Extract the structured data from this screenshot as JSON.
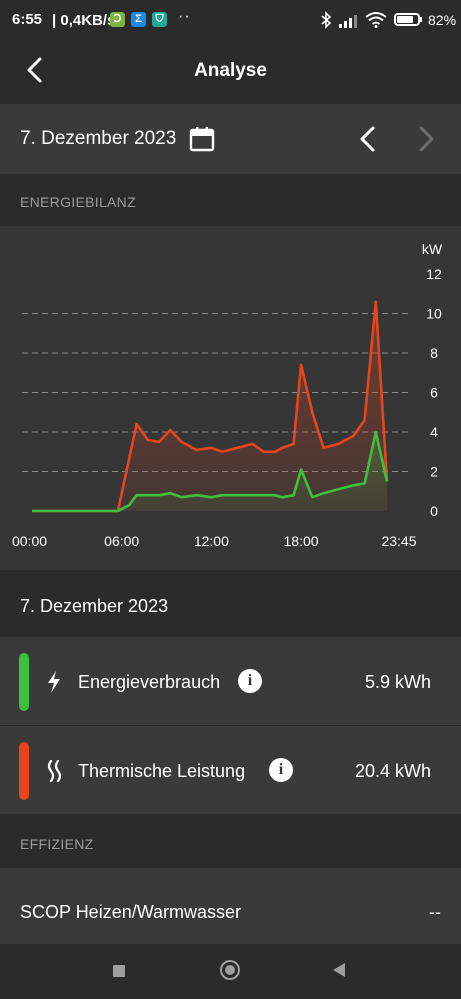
{
  "status_bar": {
    "time": "6:55",
    "speed": "| 0,4KB/s",
    "app_icons": [
      {
        "name": "app-icon-1",
        "glyph": "Ↄ",
        "color": "#8bc34a"
      },
      {
        "name": "app-icon-sigma",
        "glyph": "Σ",
        "color": "#1e88e5"
      },
      {
        "name": "app-icon-shield",
        "glyph": "⛉",
        "color": "#26a69a"
      }
    ],
    "dots": "··",
    "battery_percent": "82",
    "battery_level": 0.82
  },
  "app_bar": {
    "title": "Analyse",
    "back_icon": "chevron-left-icon"
  },
  "date_bar": {
    "date": "7. Dezember 2023",
    "calendar_icon": "calendar-icon",
    "prev_icon": "chevron-left-icon",
    "next_icon": "chevron-right-icon",
    "next_enabled": false
  },
  "sections": {
    "energy": "ENERGIEBILANZ",
    "efficiency": "EFFIZIENZ"
  },
  "chart_data": {
    "type": "area",
    "ylabel": "kW",
    "ylim": [
      0,
      12
    ],
    "yticks": [
      "12",
      "10",
      "8",
      "6",
      "4",
      "2",
      "0"
    ],
    "xticks": [
      "00:00",
      "06:00",
      "12:00",
      "18:00",
      "23:45"
    ],
    "x_hours": [
      0,
      6,
      12,
      18,
      23.75
    ],
    "grid": "dashed horizontal",
    "series": [
      {
        "name": "Thermische Leistung",
        "color": "#e6451e",
        "x": [
          0,
          5.75,
          7.0,
          7.75,
          8.5,
          9.25,
          10.0,
          11.0,
          12.0,
          12.75,
          13.75,
          14.75,
          15.5,
          16.25,
          16.75,
          17.5,
          18.0,
          18.75,
          19.5,
          20.5,
          21.5,
          22.25,
          23.0,
          23.75
        ],
        "values": [
          0,
          0,
          4.4,
          3.6,
          3.5,
          4.1,
          3.5,
          3.1,
          3.2,
          3.0,
          3.2,
          3.4,
          3.0,
          3.0,
          3.2,
          3.4,
          7.4,
          5.0,
          3.2,
          3.4,
          3.8,
          4.6,
          10.6,
          1.5
        ]
      },
      {
        "name": "Energieverbrauch",
        "color": "#3fbf3f",
        "x": [
          0,
          5.75,
          6.5,
          7.0,
          7.75,
          8.5,
          9.25,
          10.0,
          11.0,
          12.0,
          12.75,
          13.75,
          14.75,
          15.5,
          16.25,
          16.75,
          17.5,
          18.0,
          18.75,
          19.5,
          20.5,
          21.5,
          22.25,
          23.0,
          23.75
        ],
        "values": [
          0,
          0,
          0.3,
          0.8,
          0.8,
          0.8,
          0.9,
          0.7,
          0.8,
          0.7,
          0.8,
          0.8,
          0.8,
          0.8,
          0.8,
          0.7,
          0.8,
          2.1,
          0.7,
          0.9,
          1.1,
          1.3,
          1.4,
          4.0,
          1.5
        ]
      }
    ]
  },
  "summary": {
    "date": "7. Dezember 2023",
    "metrics": [
      {
        "label": "Energieverbrauch",
        "value": "5.9 kWh",
        "color": "#3fbf3f",
        "icon": "lightning-icon",
        "info": "i"
      },
      {
        "label": "Thermische Leistung",
        "value": "20.4 kWh",
        "color": "#e6451e",
        "icon": "heat-waves-icon",
        "info": "i"
      }
    ]
  },
  "efficiency": {
    "label": "SCOP Heizen/Warmwasser",
    "value": "--"
  },
  "nav": {
    "square_icon": "recents-square-icon",
    "home_icon": "home-circle-icon",
    "back_icon": "back-triangle-icon"
  }
}
